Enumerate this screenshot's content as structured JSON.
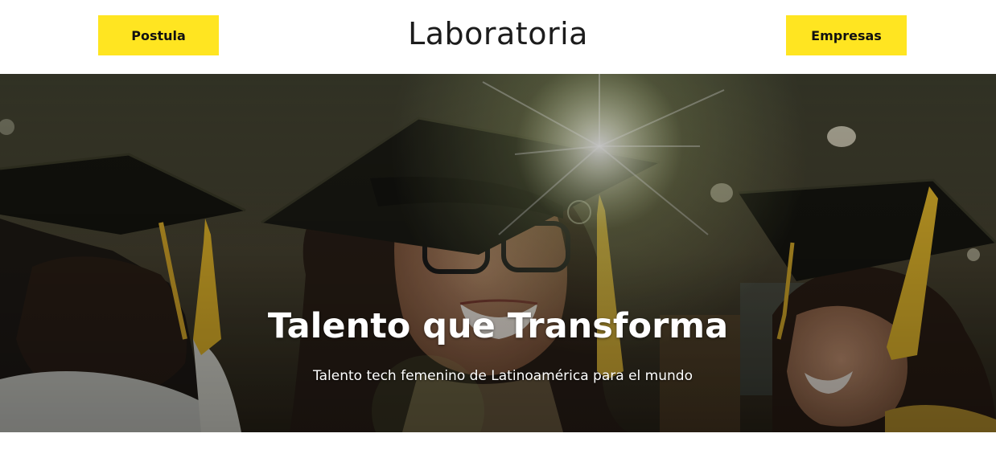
{
  "header": {
    "left_button_label": "Postula",
    "logo_text": "Laboratoria",
    "right_button_label": "Empresas"
  },
  "hero": {
    "title": "Talento que Transforma",
    "subtitle": "Talento tech femenino de Latinoamérica para el mundo",
    "image_subject": "graduation-photo"
  },
  "colors": {
    "accent_yellow": "#ffe521",
    "logo_text": "#1c1c1c",
    "hero_text": "#ffffff"
  }
}
